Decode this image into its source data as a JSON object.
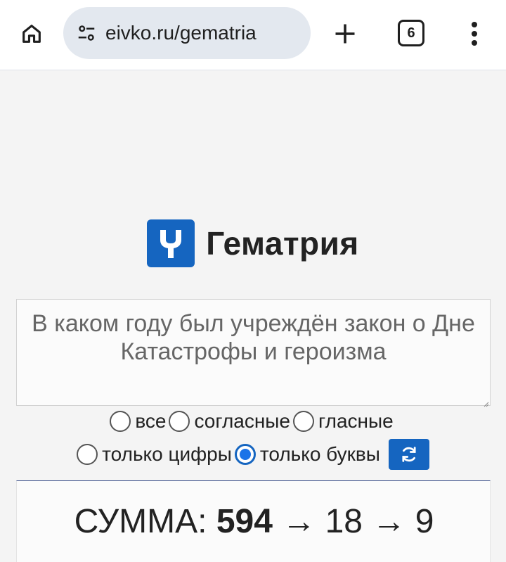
{
  "browser": {
    "url": "eivko.ru/gematria",
    "tab_count": "6",
    "icons": [
      "home-icon",
      "site-settings-icon",
      "new-tab-icon",
      "tab-switcher-icon",
      "more-menu-icon"
    ]
  },
  "header": {
    "logo_icon": "y-logo-icon",
    "title": "Гематрия",
    "accent_color": "#1565c0"
  },
  "query": {
    "value": "В каком году был учреждён закон о Дне Катастрофы и героизма"
  },
  "options": {
    "row1": [
      {
        "label": "все",
        "checked": false
      },
      {
        "label": "согласные",
        "checked": false
      },
      {
        "label": "гласные",
        "checked": false
      }
    ],
    "row2": [
      {
        "label": "только цифры",
        "checked": false
      },
      {
        "label": "только буквы",
        "checked": true
      }
    ],
    "refresh_icon": "refresh-icon"
  },
  "result": {
    "label": "СУММА:",
    "sum": "594",
    "arrow": "→",
    "step1": "18",
    "step2": "9"
  }
}
